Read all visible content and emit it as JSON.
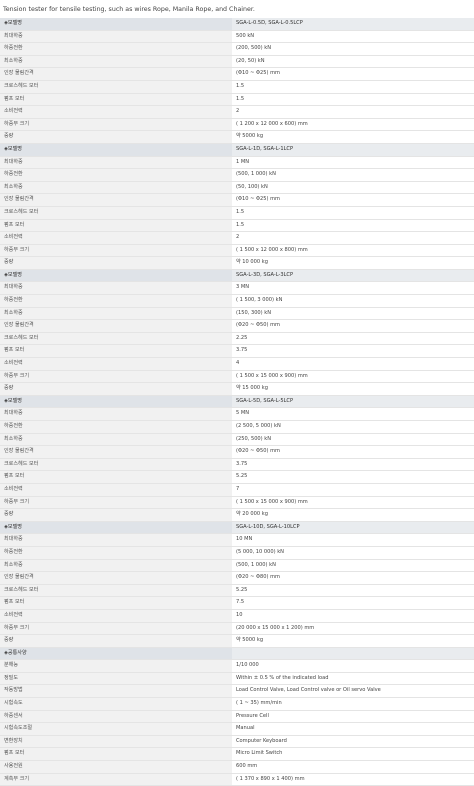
{
  "intro": "Tension tester for tensile testing, such as wires Rope, Manila Rope, and Chainer.",
  "rows": [
    {
      "k": "◈모델명",
      "v": "SGA-L-0.5D, SGA-L-0.5LCP",
      "h": true
    },
    {
      "k": "최대하중",
      "v": "500 kN"
    },
    {
      "k": "하중전환",
      "v": "(200, 500) kN"
    },
    {
      "k": "최소하중",
      "v": "(20, 50) kN"
    },
    {
      "k": "인장 물림간격",
      "v": "(Φ10 ~ Φ25) mm"
    },
    {
      "k": "크로스헤드 모터",
      "v": "1.5"
    },
    {
      "k": "펌프 모터",
      "v": "1.5"
    },
    {
      "k": "소비전력",
      "v": "2"
    },
    {
      "k": "하중부 크기",
      "v": "( 1 200 x 12 000 x 600) mm"
    },
    {
      "k": "중량",
      "v": "약 5000 kg"
    },
    {
      "k": "◈모델명",
      "v": "SGA-L-1D, SGA-L-1LCP",
      "h": true
    },
    {
      "k": "최대하중",
      "v": "1 MN"
    },
    {
      "k": "하중전환",
      "v": "(500, 1 000) kN"
    },
    {
      "k": "최소하중",
      "v": "(50, 100) kN"
    },
    {
      "k": "인장 물림간격",
      "v": "(Φ10 ~ Φ25) mm"
    },
    {
      "k": "크로스헤드 모터",
      "v": "1.5"
    },
    {
      "k": "펌프 모터",
      "v": "1.5"
    },
    {
      "k": "소비전력",
      "v": "2"
    },
    {
      "k": "하중부 크기",
      "v": "( 1 500 x 12 000 x 800) mm"
    },
    {
      "k": "중량",
      "v": "약 10 000 kg"
    },
    {
      "k": "◈모델명",
      "v": "SGA-L-3D, SGA-L-3LCP",
      "h": true
    },
    {
      "k": "최대하중",
      "v": "3 MN"
    },
    {
      "k": "하중전환",
      "v": "( 1 500, 3 000) kN"
    },
    {
      "k": "최소하중",
      "v": "(150, 300) kN"
    },
    {
      "k": "인장 물림간격",
      "v": "(Φ20 ~ Φ50) mm"
    },
    {
      "k": "크로스헤드 모터",
      "v": "2.25"
    },
    {
      "k": "펌프 모터",
      "v": "3.75"
    },
    {
      "k": "소비전력",
      "v": "4"
    },
    {
      "k": "하중부 크기",
      "v": "( 1 500 x 15 000 x 900) mm"
    },
    {
      "k": "중량",
      "v": "약 15 000 kg"
    },
    {
      "k": "◈모델명",
      "v": "SGA-L-5D, SGA-L-5LCP",
      "h": true
    },
    {
      "k": "최대하중",
      "v": "5 MN"
    },
    {
      "k": "하중전환",
      "v": "(2 500, 5 000) kN"
    },
    {
      "k": "최소하중",
      "v": "(250, 500) kN"
    },
    {
      "k": "인장 물림간격",
      "v": "(Φ20 ~ Φ50) mm"
    },
    {
      "k": "크로스헤드 모터",
      "v": "3.75"
    },
    {
      "k": "펌프 모터",
      "v": "5.25"
    },
    {
      "k": "소비전력",
      "v": "7"
    },
    {
      "k": "하중부 크기",
      "v": "( 1 500 x 15 000 x 900) mm"
    },
    {
      "k": "중량",
      "v": "약 20 000 kg"
    },
    {
      "k": "◈모델명",
      "v": "SGA-L-10D, SGA-L-10LCP",
      "h": true
    },
    {
      "k": "최대하중",
      "v": "10 MN"
    },
    {
      "k": "하중전환",
      "v": "(5 000, 10 000) kN"
    },
    {
      "k": "최소하중",
      "v": "(500, 1 000) kN"
    },
    {
      "k": "인장 물림간격",
      "v": "(Φ20 ~ Φ80) mm"
    },
    {
      "k": "크로스헤드 모터",
      "v": "5.25"
    },
    {
      "k": "펌프 모터",
      "v": "7.5"
    },
    {
      "k": "소비전력",
      "v": "10"
    },
    {
      "k": "하중부 크기",
      "v": "(20 000 x 15 000 x 1 200) mm"
    },
    {
      "k": "중량",
      "v": "약 5000 kg"
    },
    {
      "k": "◈공통사양",
      "v": "",
      "h": true
    },
    {
      "k": "분해능",
      "v": "1/10 000"
    },
    {
      "k": "정밀도",
      "v": "Within ± 0.5 % of the indicated load"
    },
    {
      "k": "작동방법",
      "v": "Load Control Valve, Load Control valve or Oil servo Valve"
    },
    {
      "k": "시험속도",
      "v": "( 1 ~ 35) mm/min"
    },
    {
      "k": "하중센서",
      "v": "Pressure Cell"
    },
    {
      "k": "시험속도조절",
      "v": "Manual"
    },
    {
      "k": "변환장치",
      "v": "Computer Keyboard"
    },
    {
      "k": "펌프 모터",
      "v": "Micro Limit Switch"
    },
    {
      "k": "사용전원",
      "v": "600 mm"
    },
    {
      "k": "계측부 크기",
      "v": "( 1 370 x 890 x 1 400) mm"
    }
  ]
}
